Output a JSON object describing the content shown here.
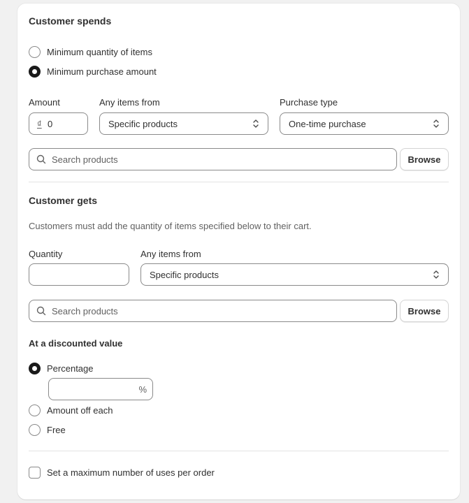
{
  "spends": {
    "title": "Customer spends",
    "options": [
      "Minimum quantity of items",
      "Minimum purchase amount"
    ],
    "selected_index": 1,
    "amount_label": "Amount",
    "amount_prefix": "₫",
    "amount_value": "0",
    "items_from_label": "Any items from",
    "items_from_value": "Specific products",
    "purchase_type_label": "Purchase type",
    "purchase_type_value": "One-time purchase",
    "search_placeholder": "Search products",
    "browse_label": "Browse"
  },
  "gets": {
    "title": "Customer gets",
    "description": "Customers must add the quantity of items specified below to their cart.",
    "quantity_label": "Quantity",
    "quantity_value": "",
    "items_from_label": "Any items from",
    "items_from_value": "Specific products",
    "search_placeholder": "Search products",
    "browse_label": "Browse"
  },
  "discount": {
    "title": "At a discounted value",
    "options": [
      "Percentage",
      "Amount off each",
      "Free"
    ],
    "selected_index": 0,
    "percent_suffix": "%",
    "percent_value": ""
  },
  "max_uses": {
    "label": "Set a maximum number of uses per order",
    "checked": false
  }
}
